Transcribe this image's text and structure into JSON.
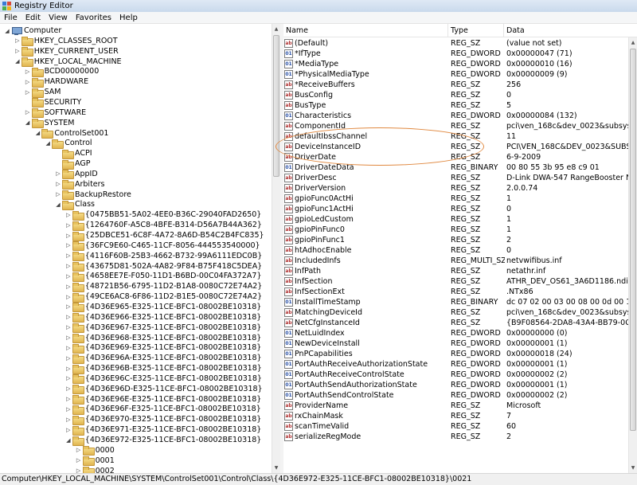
{
  "window": {
    "title": "Registry Editor"
  },
  "menu": [
    "File",
    "Edit",
    "View",
    "Favorites",
    "Help"
  ],
  "tree": [
    {
      "label": "Computer",
      "depth": 0,
      "state": "open",
      "icon": "computer-icon"
    },
    {
      "label": "HKEY_CLASSES_ROOT",
      "depth": 1,
      "state": "closed"
    },
    {
      "label": "HKEY_CURRENT_USER",
      "depth": 1,
      "state": "closed"
    },
    {
      "label": "HKEY_LOCAL_MACHINE",
      "depth": 1,
      "state": "open"
    },
    {
      "label": "BCD00000000",
      "depth": 2,
      "state": "closed"
    },
    {
      "label": "HARDWARE",
      "depth": 2,
      "state": "closed"
    },
    {
      "label": "SAM",
      "depth": 2,
      "state": "closed"
    },
    {
      "label": "SECURITY",
      "depth": 2,
      "state": "none"
    },
    {
      "label": "SOFTWARE",
      "depth": 2,
      "state": "closed"
    },
    {
      "label": "SYSTEM",
      "depth": 2,
      "state": "open"
    },
    {
      "label": "ControlSet001",
      "depth": 3,
      "state": "open"
    },
    {
      "label": "Control",
      "depth": 4,
      "state": "open"
    },
    {
      "label": "ACPI",
      "depth": 5,
      "state": "none"
    },
    {
      "label": "AGP",
      "depth": 5,
      "state": "none"
    },
    {
      "label": "AppID",
      "depth": 5,
      "state": "closed"
    },
    {
      "label": "Arbiters",
      "depth": 5,
      "state": "closed"
    },
    {
      "label": "BackupRestore",
      "depth": 5,
      "state": "closed"
    },
    {
      "label": "Class",
      "depth": 5,
      "state": "open"
    },
    {
      "label": "{0475BB51-5A02-4EE0-B36C-29040FAD2650}",
      "depth": 6,
      "state": "closed"
    },
    {
      "label": "{1264760F-A5C8-4BFE-B314-D56A7B44A362}",
      "depth": 6,
      "state": "closed"
    },
    {
      "label": "{25DBCE51-6C8F-4A72-8A6D-B54C2B4FC835}",
      "depth": 6,
      "state": "closed"
    },
    {
      "label": "{36FC9E60-C465-11CF-8056-444553540000}",
      "depth": 6,
      "state": "closed"
    },
    {
      "label": "{4116F60B-25B3-4662-B732-99A6111EDC0B}",
      "depth": 6,
      "state": "closed"
    },
    {
      "label": "{43675D81-502A-4A82-9F84-B75F418C5DEA}",
      "depth": 6,
      "state": "closed"
    },
    {
      "label": "{4658EE7E-F050-11D1-B6BD-00C04FA372A7}",
      "depth": 6,
      "state": "closed"
    },
    {
      "label": "{48721B56-6795-11D2-B1A8-0080C72E74A2}",
      "depth": 6,
      "state": "closed"
    },
    {
      "label": "{49CE6AC8-6F86-11D2-B1E5-0080C72E74A2}",
      "depth": 6,
      "state": "closed"
    },
    {
      "label": "{4D36E965-E325-11CE-BFC1-08002BE10318}",
      "depth": 6,
      "state": "closed"
    },
    {
      "label": "{4D36E966-E325-11CE-BFC1-08002BE10318}",
      "depth": 6,
      "state": "closed"
    },
    {
      "label": "{4D36E967-E325-11CE-BFC1-08002BE10318}",
      "depth": 6,
      "state": "closed"
    },
    {
      "label": "{4D36E968-E325-11CE-BFC1-08002BE10318}",
      "depth": 6,
      "state": "closed"
    },
    {
      "label": "{4D36E969-E325-11CE-BFC1-08002BE10318}",
      "depth": 6,
      "state": "closed"
    },
    {
      "label": "{4D36E96A-E325-11CE-BFC1-08002BE10318}",
      "depth": 6,
      "state": "closed"
    },
    {
      "label": "{4D36E96B-E325-11CE-BFC1-08002BE10318}",
      "depth": 6,
      "state": "closed"
    },
    {
      "label": "{4D36E96C-E325-11CE-BFC1-08002BE10318}",
      "depth": 6,
      "state": "closed"
    },
    {
      "label": "{4D36E96D-E325-11CE-BFC1-08002BE10318}",
      "depth": 6,
      "state": "closed"
    },
    {
      "label": "{4D36E96E-E325-11CE-BFC1-08002BE10318}",
      "depth": 6,
      "state": "closed"
    },
    {
      "label": "{4D36E96F-E325-11CE-BFC1-08002BE10318}",
      "depth": 6,
      "state": "closed"
    },
    {
      "label": "{4D36E970-E325-11CE-BFC1-08002BE10318}",
      "depth": 6,
      "state": "closed"
    },
    {
      "label": "{4D36E971-E325-11CE-BFC1-08002BE10318}",
      "depth": 6,
      "state": "closed"
    },
    {
      "label": "{4D36E972-E325-11CE-BFC1-08002BE10318}",
      "depth": 6,
      "state": "open"
    },
    {
      "label": "0000",
      "depth": 7,
      "state": "closed"
    },
    {
      "label": "0001",
      "depth": 7,
      "state": "closed"
    },
    {
      "label": "0002",
      "depth": 7,
      "state": "closed"
    }
  ],
  "columns": {
    "name": "Name",
    "type": "Type",
    "data": "Data"
  },
  "values": [
    {
      "name": "(Default)",
      "type": "REG_SZ",
      "data": "(value not set)",
      "kind": "str"
    },
    {
      "name": "*IfType",
      "type": "REG_DWORD",
      "data": "0x00000047 (71)",
      "kind": "bin"
    },
    {
      "name": "*MediaType",
      "type": "REG_DWORD",
      "data": "0x00000010 (16)",
      "kind": "bin"
    },
    {
      "name": "*PhysicalMediaType",
      "type": "REG_DWORD",
      "data": "0x00000009 (9)",
      "kind": "bin"
    },
    {
      "name": "*ReceiveBuffers",
      "type": "REG_SZ",
      "data": "256",
      "kind": "str"
    },
    {
      "name": "BusConfig",
      "type": "REG_SZ",
      "data": "0",
      "kind": "str"
    },
    {
      "name": "BusType",
      "type": "REG_SZ",
      "data": "5",
      "kind": "str"
    },
    {
      "name": "Characteristics",
      "type": "REG_DWORD",
      "data": "0x00000084 (132)",
      "kind": "bin"
    },
    {
      "name": "ComponentId",
      "type": "REG_SZ",
      "data": "pci\\ven_168c&dev_0023&subsys_3a6b1...",
      "kind": "str"
    },
    {
      "name": "defaultIbssChannel",
      "type": "REG_SZ",
      "data": "11",
      "kind": "str"
    },
    {
      "name": "DeviceInstanceID",
      "type": "REG_SZ",
      "data": "PCI\\VEN_168C&DEV_0023&SUBSYS_3A6...",
      "kind": "str"
    },
    {
      "name": "DriverDate",
      "type": "REG_SZ",
      "data": "6-9-2009",
      "kind": "str"
    },
    {
      "name": "DriverDateData",
      "type": "REG_BINARY",
      "data": "00 80 55 3b 95 e8 c9 01",
      "kind": "bin"
    },
    {
      "name": "DriverDesc",
      "type": "REG_SZ",
      "data": "D-Link DWA-547 RangeBooster N650 D...",
      "kind": "str"
    },
    {
      "name": "DriverVersion",
      "type": "REG_SZ",
      "data": "2.0.0.74",
      "kind": "str"
    },
    {
      "name": "gpioFunc0ActHi",
      "type": "REG_SZ",
      "data": "1",
      "kind": "str"
    },
    {
      "name": "gpioFunc1ActHi",
      "type": "REG_SZ",
      "data": "0",
      "kind": "str"
    },
    {
      "name": "gpioLedCustom",
      "type": "REG_SZ",
      "data": "1",
      "kind": "str"
    },
    {
      "name": "gpioPinFunc0",
      "type": "REG_SZ",
      "data": "1",
      "kind": "str"
    },
    {
      "name": "gpioPinFunc1",
      "type": "REG_SZ",
      "data": "2",
      "kind": "str"
    },
    {
      "name": "htAdhocEnable",
      "type": "REG_SZ",
      "data": "0",
      "kind": "str"
    },
    {
      "name": "IncludedInfs",
      "type": "REG_MULTI_SZ",
      "data": "netvwifibus.inf",
      "kind": "str"
    },
    {
      "name": "InfPath",
      "type": "REG_SZ",
      "data": "netathr.inf",
      "kind": "str"
    },
    {
      "name": "InfSection",
      "type": "REG_SZ",
      "data": "ATHR_DEV_OS61_3A6D1186.ndi",
      "kind": "str"
    },
    {
      "name": "InfSectionExt",
      "type": "REG_SZ",
      "data": ".NTx86",
      "kind": "str"
    },
    {
      "name": "InstallTimeStamp",
      "type": "REG_BINARY",
      "data": "dc 07 02 00 03 00 08 00 0d 00 14 00 2e ...",
      "kind": "bin"
    },
    {
      "name": "MatchingDeviceId",
      "type": "REG_SZ",
      "data": "pci\\ven_168c&dev_0023&subsys_3a6b1...",
      "kind": "str"
    },
    {
      "name": "NetCfgInstanceId",
      "type": "REG_SZ",
      "data": "{B9F08564-2DA8-43A4-BB79-0CA0C7D...",
      "kind": "str"
    },
    {
      "name": "NetLuidIndex",
      "type": "REG_DWORD",
      "data": "0x00000000 (0)",
      "kind": "bin"
    },
    {
      "name": "NewDeviceInstall",
      "type": "REG_DWORD",
      "data": "0x00000001 (1)",
      "kind": "bin"
    },
    {
      "name": "PnPCapabilities",
      "type": "REG_DWORD",
      "data": "0x00000018 (24)",
      "kind": "bin"
    },
    {
      "name": "PortAuthReceiveAuthorizationState",
      "type": "REG_DWORD",
      "data": "0x00000001 (1)",
      "kind": "bin"
    },
    {
      "name": "PortAuthReceiveControlState",
      "type": "REG_DWORD",
      "data": "0x00000002 (2)",
      "kind": "bin"
    },
    {
      "name": "PortAuthSendAuthorizationState",
      "type": "REG_DWORD",
      "data": "0x00000001 (1)",
      "kind": "bin"
    },
    {
      "name": "PortAuthSendControlState",
      "type": "REG_DWORD",
      "data": "0x00000002 (2)",
      "kind": "bin"
    },
    {
      "name": "ProviderName",
      "type": "REG_SZ",
      "data": "Microsoft",
      "kind": "str"
    },
    {
      "name": "rxChainMask",
      "type": "REG_SZ",
      "data": "7",
      "kind": "str"
    },
    {
      "name": "scanTimeValid",
      "type": "REG_SZ",
      "data": "60",
      "kind": "str"
    },
    {
      "name": "serializeRegMode",
      "type": "REG_SZ",
      "data": "2",
      "kind": "str"
    }
  ],
  "statusbar": "Computer\\HKEY_LOCAL_MACHINE\\SYSTEM\\ControlSet001\\Control\\Class\\{4D36E972-E325-11CE-BFC1-08002BE10318}\\0021",
  "colors": {
    "highlight_ellipse": "#e0883f",
    "folder": "#e8c35f"
  }
}
